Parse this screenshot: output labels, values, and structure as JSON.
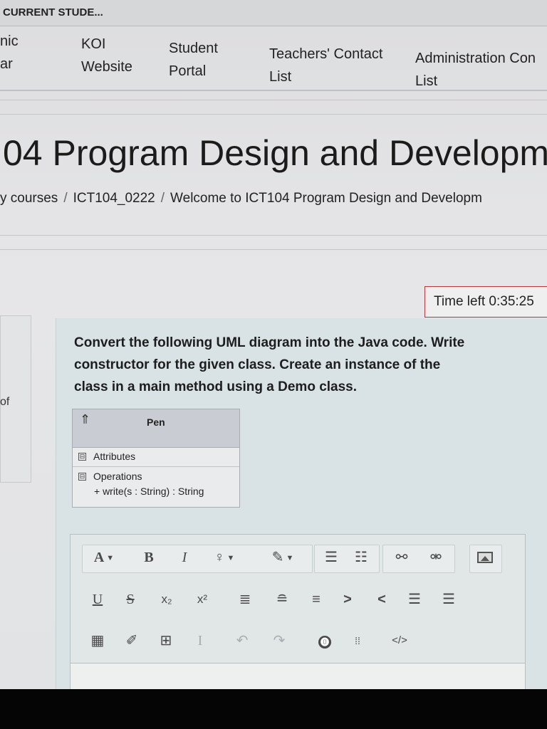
{
  "topbar": {
    "title": "CURRENT STUDE..."
  },
  "nav": {
    "items": [
      {
        "line1": "nic",
        "line2": "ar"
      },
      {
        "line1": "KOI",
        "line2": "Website"
      },
      {
        "line1": "Student",
        "line2": "Portal"
      },
      {
        "line1": "Teachers' Contact",
        "line2": "List"
      },
      {
        "line1": "Administration Con",
        "line2": "List"
      }
    ]
  },
  "course": {
    "title": "04 Program Design and Developm"
  },
  "breadcrumb": {
    "items": [
      "y courses",
      "ICT104_0222",
      "Welcome to ICT104 Program Design and Developm"
    ],
    "separator": "/"
  },
  "timer": {
    "text": "Time left 0:35:25"
  },
  "left_panel": {
    "of_label": "of"
  },
  "question": {
    "text_lines": [
      "Convert the following UML diagram into the Java code. Write",
      "constructor for the given class. Create an instance of the",
      "class in a main method using a Demo class."
    ]
  },
  "uml": {
    "class_name": "Pen",
    "attributes_label": "Attributes",
    "operations_label": "Operations",
    "operation": "+ write(s : String) : String",
    "collapse_symbol": "⊟",
    "chevron": "⇑"
  },
  "editor": {
    "row1": {
      "font": "A",
      "bold": "B",
      "italic": "I",
      "highlight": "♀",
      "brush": "✎",
      "bullets": "☰",
      "numbers": "☷",
      "link": "⚯",
      "unlink": "⚮"
    },
    "row2": {
      "underline": "U",
      "strike": "S",
      "subscript": "x₂",
      "superscript": "x²",
      "align_left": "≣",
      "align_center": "≘",
      "align_right": "≡",
      "indent": ">",
      "outdent": "<",
      "list1": "☰",
      "list2": "☰"
    },
    "row3": {
      "calc": "▦",
      "edit": "✐",
      "table": "⊞",
      "cursor": "I",
      "undo": "↶",
      "redo": "↷",
      "accessibility": "⓿",
      "more": "⁞⁞",
      "html": "</>"
    }
  },
  "colors": {
    "timer_border": "#b33a3a",
    "question_bg": "#d9e3e5",
    "uml_header": "#c9cdd3"
  }
}
